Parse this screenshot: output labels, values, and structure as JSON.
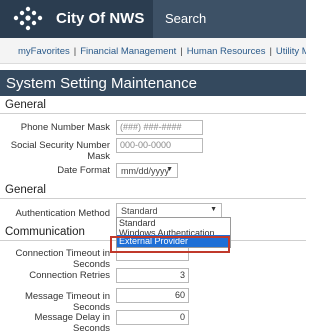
{
  "header": {
    "title": "City Of NWS",
    "search_placeholder": "Search",
    "logo_icon": "gear-cluster-icon",
    "bg_color": "#2b3d50",
    "search_bg_color": "#3d5166"
  },
  "nav": {
    "items": [
      "myFavorites",
      "Financial Management",
      "Human Resources",
      "Utility Ma"
    ]
  },
  "page": {
    "title": "System Setting Maintenance",
    "title_bg_color": "#34495e"
  },
  "general": {
    "heading": "General",
    "phone_mask_label": "Phone Number Mask",
    "phone_mask_value": "(###) ###-####",
    "ssn_mask_label_1": "Social Security Number",
    "ssn_mask_label_2": "Mask",
    "ssn_mask_value": "000-00-0000",
    "date_format_label": "Date Format",
    "date_format_value": "mm/dd/yyyy"
  },
  "general2": {
    "heading": "General",
    "auth_method_label": "Authentication Method",
    "auth_method_value": "Standard",
    "auth_options": [
      "Standard",
      "Windows Authentication",
      "External Provider"
    ],
    "selected_option": "External Provider",
    "highlight_color": "#c0392b",
    "selected_bg_color": "#1e6fd6"
  },
  "communication": {
    "heading": "Communication",
    "conn_timeout_label_1": "Connection Timeout in",
    "conn_timeout_label_2": "Seconds",
    "conn_retries_label": "Connection Retries",
    "conn_retries_value": "3",
    "msg_timeout_label_1": "Message Timeout in",
    "msg_timeout_label_2": "Seconds",
    "msg_timeout_value": "60",
    "msg_delay_label_1": "Message Delay in",
    "msg_delay_label_2": "Seconds",
    "msg_delay_value": "0"
  }
}
